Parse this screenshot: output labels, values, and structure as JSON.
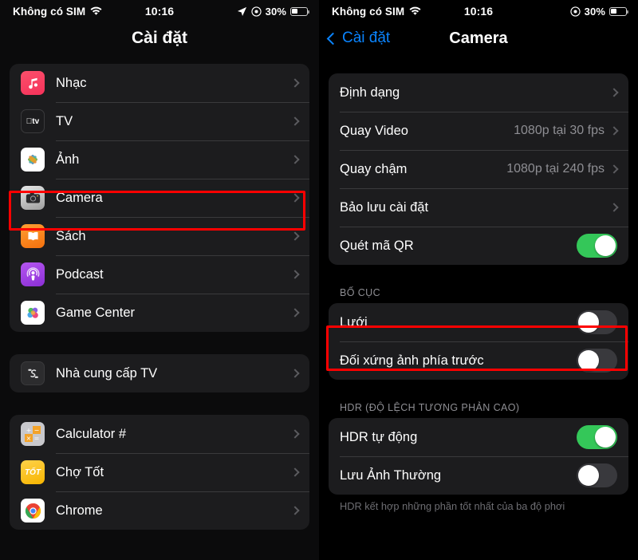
{
  "left": {
    "status": {
      "carrier": "Không có SIM",
      "wifi_icon": "wifi-icon",
      "time": "10:16",
      "location_icon": "location-arrow-icon",
      "focus_icon": "do-not-disturb-icon",
      "battery_pct": "30%",
      "battery_icon": "battery-icon"
    },
    "nav": {
      "title": "Cài đặt"
    },
    "groups": [
      {
        "items": [
          {
            "label": "Nhạc",
            "icon": "music-app-icon",
            "icon_class": "ic-music"
          },
          {
            "label": "TV",
            "icon": "apple-tv-app-icon",
            "icon_class": "ic-tv"
          },
          {
            "label": "Ảnh",
            "icon": "photos-app-icon",
            "icon_class": "ic-photos"
          },
          {
            "label": "Camera",
            "icon": "camera-app-icon",
            "icon_class": "ic-camera"
          },
          {
            "label": "Sách",
            "icon": "books-app-icon",
            "icon_class": "ic-books"
          },
          {
            "label": "Podcast",
            "icon": "podcasts-app-icon",
            "icon_class": "ic-podcast"
          },
          {
            "label": "Game Center",
            "icon": "game-center-app-icon",
            "icon_class": "ic-gamecenter"
          }
        ]
      },
      {
        "items": [
          {
            "label": "Nhà cung cấp TV",
            "icon": "tv-provider-icon",
            "icon_class": "ic-tvprovider"
          }
        ]
      },
      {
        "items": [
          {
            "label": "Calculator #",
            "icon": "calculator-app-icon",
            "icon_class": "ic-calculator"
          },
          {
            "label": "Chợ Tốt",
            "icon": "chotot-app-icon",
            "icon_class": "ic-chotot"
          },
          {
            "label": "Chrome",
            "icon": "chrome-app-icon",
            "icon_class": "ic-chrome"
          }
        ]
      }
    ],
    "highlight_color": "#ff0000"
  },
  "right": {
    "status": {
      "carrier": "Không có SIM",
      "wifi_icon": "wifi-icon",
      "time": "10:16",
      "focus_icon": "do-not-disturb-icon",
      "battery_pct": "30%",
      "battery_icon": "battery-icon"
    },
    "nav": {
      "back_label": "Cài đặt",
      "title": "Camera"
    },
    "group1": [
      {
        "label": "Định dạng",
        "value": "",
        "type": "link"
      },
      {
        "label": "Quay Video",
        "value": "1080p tại 30 fps",
        "type": "link"
      },
      {
        "label": "Quay chậm",
        "value": "1080p tại 240 fps",
        "type": "link"
      },
      {
        "label": "Bảo lưu cài đặt",
        "value": "",
        "type": "link"
      },
      {
        "label": "Quét mã QR",
        "value": "",
        "type": "toggle",
        "on": true
      }
    ],
    "section_layout": {
      "header": "BỐ CỤC",
      "items": [
        {
          "label": "Lưới",
          "type": "toggle",
          "on": false
        },
        {
          "label": "Đối xứng ảnh phía trước",
          "type": "toggle",
          "on": false
        }
      ]
    },
    "section_hdr": {
      "header": "HDR (ĐỘ LỆCH TƯƠNG PHẢN CAO)",
      "items": [
        {
          "label": "HDR tự động",
          "type": "toggle",
          "on": true
        },
        {
          "label": "Lưu Ảnh Thường",
          "type": "toggle",
          "on": false
        }
      ],
      "footer": "HDR kết hợp những phần tốt nhất của ba độ phơi"
    },
    "highlight_color": "#ff0000"
  },
  "colors": {
    "accent_blue": "#0a84ff",
    "toggle_on": "#34c759",
    "toggle_off": "#39393d",
    "cell_bg": "#1c1c1e",
    "page_bg": "#000000",
    "highlight": "#ff0000"
  }
}
